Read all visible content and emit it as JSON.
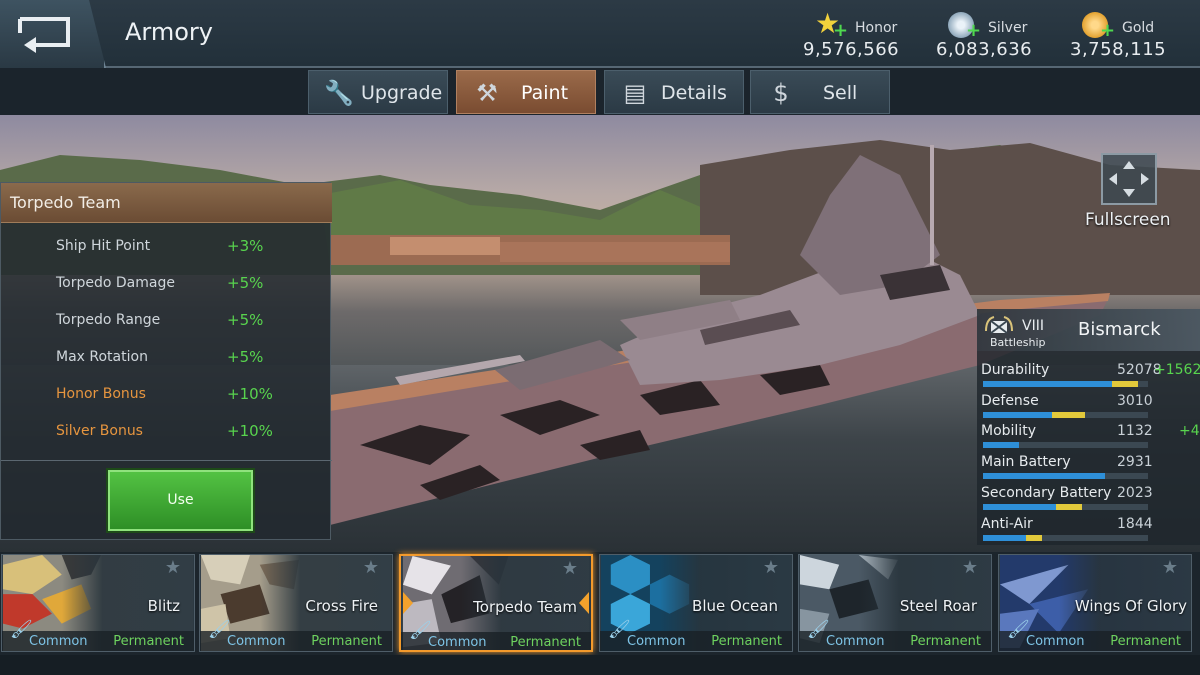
{
  "header": {
    "title": "Armory",
    "back_icon": "back-arrow-icon",
    "currencies": [
      {
        "label": "Honor",
        "value": "9,576,566",
        "icon": "star-icon",
        "color": "#f2d23c"
      },
      {
        "label": "Silver",
        "value": "6,083,636",
        "icon": "silver-coin-icon",
        "color": "#b9cbd8"
      },
      {
        "label": "Gold",
        "value": "3,758,115",
        "icon": "gold-coin-icon",
        "color": "#e3a230"
      }
    ]
  },
  "tabs": [
    {
      "label": "Upgrade",
      "icon": "wrench-icon",
      "active": false
    },
    {
      "label": "Paint",
      "icon": "hammer-icon",
      "active": true
    },
    {
      "label": "Details",
      "icon": "folder-icon",
      "active": false
    },
    {
      "label": "Sell",
      "icon": "dollar-icon",
      "active": false
    }
  ],
  "perk_panel": {
    "title": "Torpedo Team",
    "perks": [
      {
        "name": "Ship Hit Point",
        "value": "+3%"
      },
      {
        "name": "Torpedo Damage",
        "value": "+5%"
      },
      {
        "name": "Torpedo Range",
        "value": "+5%"
      },
      {
        "name": "Max Rotation",
        "value": "+5%"
      },
      {
        "name": "Honor Bonus",
        "value": "+10%"
      },
      {
        "name": "Silver Bonus",
        "value": "+10%"
      }
    ],
    "use_label": "Use"
  },
  "fullscreen": {
    "label": "Fullscreen"
  },
  "ship": {
    "tier": "VIII",
    "name": "Bismarck",
    "class": "Battleship",
    "stats": [
      {
        "name": "Durability",
        "value": "52078",
        "bonus": "+1562",
        "fill": 0.78,
        "extra": 0.16
      },
      {
        "name": "Defense",
        "value": "3010",
        "bonus": "",
        "fill": 0.42,
        "extra": 0.2
      },
      {
        "name": "Mobility",
        "value": "1132",
        "bonus": "+4",
        "fill": 0.22,
        "extra": 0.0
      },
      {
        "name": "Main Battery",
        "value": "2931",
        "bonus": "",
        "fill": 0.74,
        "extra": 0.0
      },
      {
        "name": "Secondary Battery",
        "value": "2023",
        "bonus": "",
        "fill": 0.44,
        "extra": 0.16
      },
      {
        "name": "Anti-Air",
        "value": "1844",
        "bonus": "",
        "fill": 0.26,
        "extra": 0.1
      }
    ]
  },
  "paints": [
    {
      "name": "Blitz",
      "rarity": "Common",
      "duration": "Permanent",
      "selected": false
    },
    {
      "name": "Cross Fire",
      "rarity": "Common",
      "duration": "Permanent",
      "selected": false
    },
    {
      "name": "Torpedo Team",
      "rarity": "Common",
      "duration": "Permanent",
      "selected": true
    },
    {
      "name": "Blue Ocean",
      "rarity": "Common",
      "duration": "Permanent",
      "selected": false
    },
    {
      "name": "Steel Roar",
      "rarity": "Common",
      "duration": "Permanent",
      "selected": false
    },
    {
      "name": "Wings Of Glory",
      "rarity": "Common",
      "duration": "Permanent",
      "selected": false
    }
  ]
}
